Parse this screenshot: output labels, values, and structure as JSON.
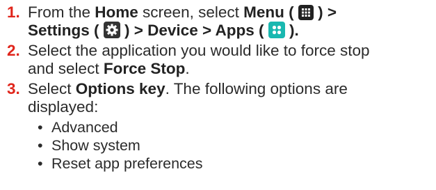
{
  "steps": [
    {
      "number": "1.",
      "l1_a": "From the ",
      "l1_home": "Home",
      "l1_b": " screen, select ",
      "l1_menu": "Menu",
      "l1_open": " ( ",
      "l1_close": " ) >",
      "l2_settings": "Settings",
      "l2_open": " ( ",
      "l2_close": " ) > ",
      "l2_device": "Device",
      "l2_gt": " > ",
      "l2_apps": "Apps",
      "l2_open2": " ( ",
      "l2_close2": " )."
    },
    {
      "number": "2.",
      "l1": "Select the application you would like to force stop",
      "l2_a": "and select ",
      "l2_force": "Force Stop",
      "l2_end": "."
    },
    {
      "number": "3.",
      "l1_a": "Select ",
      "l1_options": "Options key",
      "l1_b": ". The following options are",
      "l2": "displayed:"
    }
  ],
  "bullets": [
    "Advanced",
    "Show system",
    "Reset app preferences"
  ],
  "colors": {
    "step_number": "#e0251b",
    "icon_dark": "#222222",
    "icon_teal": "#19b8b0"
  },
  "icons": [
    "menu-grid-icon",
    "settings-gear-icon",
    "apps-icon"
  ]
}
